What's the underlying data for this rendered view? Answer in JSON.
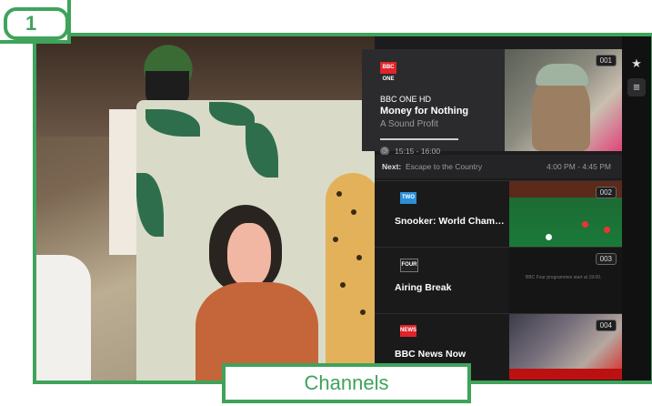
{
  "badge": {
    "number": "1"
  },
  "caption": {
    "label": "Channels"
  },
  "sidebar": {
    "icons": [
      "star-icon",
      "guide-list-icon"
    ]
  },
  "current": {
    "logo": "BBC ONE",
    "channel_name": "BBC ONE HD",
    "title": "Money for Nothing",
    "subtitle": "A Sound Profit",
    "time": "15:15 - 16:00",
    "number": "001",
    "progress": 1.0
  },
  "next": {
    "label": "Next:",
    "title": "Escape to the Country",
    "time": "4:00 PM - 4:45 PM"
  },
  "channels": [
    {
      "logo": "TWO",
      "title": "Snooker: World Champio...",
      "number": "002",
      "logo_color": "#2b8fd6"
    },
    {
      "logo": "FOUR",
      "title": "Airing Break",
      "number": "003",
      "logo_color": "#222222",
      "thumb_text": "BBC Four programmes start at 19:00."
    },
    {
      "logo": "NEWS",
      "title": "BBC News Now",
      "number": "004",
      "logo_color": "#e0242a"
    }
  ],
  "colors": {
    "accent": "#3fa35b",
    "panel": "#1c1c1e"
  }
}
